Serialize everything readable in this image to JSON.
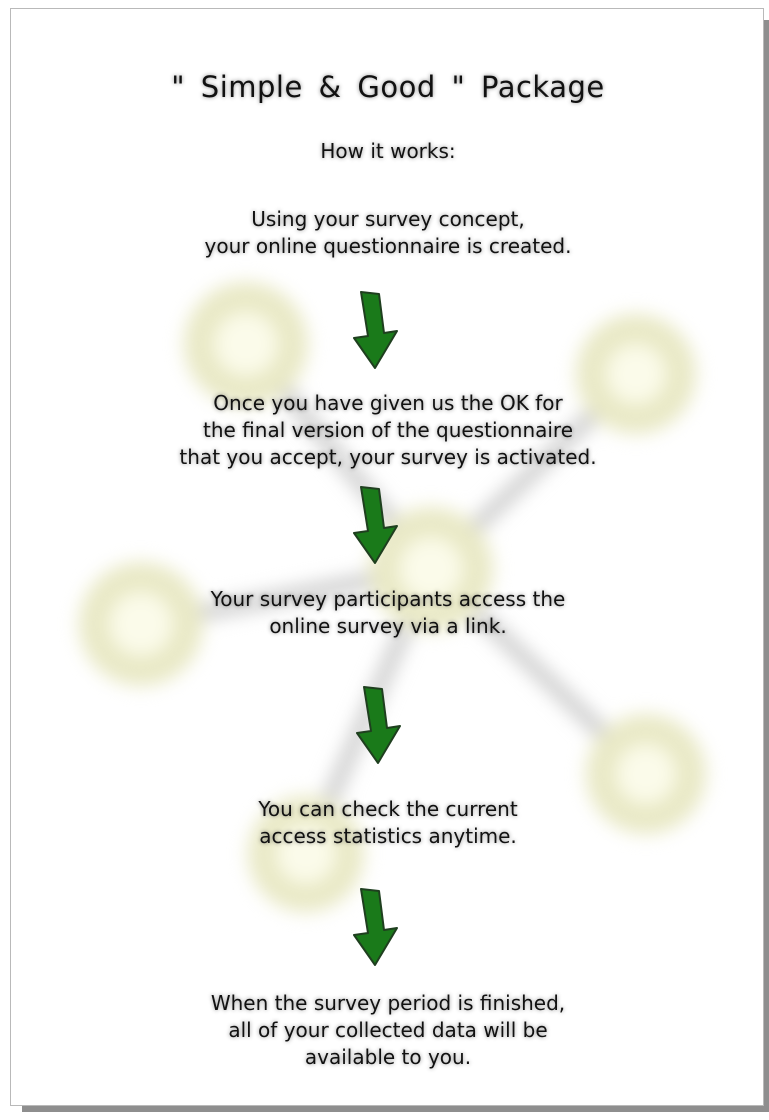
{
  "title": "\" Simple  &  Good \"  Package",
  "subtitle": "How it works:",
  "steps": [
    {
      "line1": "Using your survey concept,",
      "line2": "your online questionnaire is created.",
      "line3": ""
    },
    {
      "line1": "Once you have given us the OK for",
      "line2": "the final version of the questionnaire",
      "line3": "that you accept, your survey is activated."
    },
    {
      "line1": "Your survey participants access the",
      "line2": "online survey via a link.",
      "line3": ""
    },
    {
      "line1": "You can check the current",
      "line2": "access statistics anytime.",
      "line3": ""
    },
    {
      "line1": "When the survey period is finished,",
      "line2": "all of your collected data will be",
      "line3": "available to you."
    }
  ],
  "icons": {
    "step_arrow": "down-arrow-icon",
    "background": "network-graph-icon"
  },
  "colors": {
    "arrow_fill": "#1a7a1a",
    "arrow_stroke": "#1f3f1f",
    "node_glow": "#f3f3d6"
  }
}
